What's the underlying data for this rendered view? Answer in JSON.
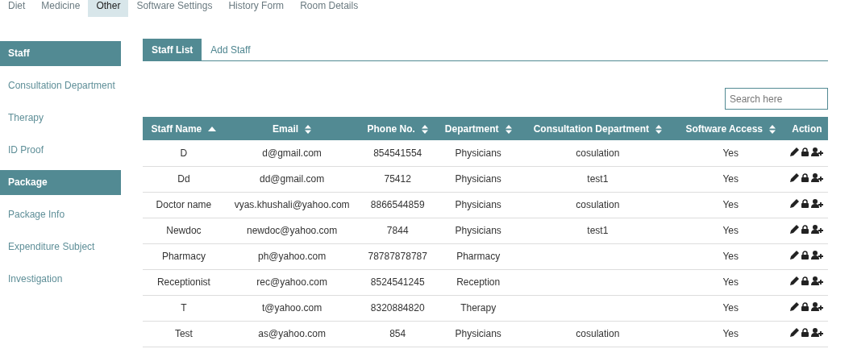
{
  "top_tabs": [
    {
      "label": "Diet",
      "selected": false
    },
    {
      "label": "Medicine",
      "selected": false
    },
    {
      "label": "Other",
      "selected": true
    },
    {
      "label": "Software Settings",
      "selected": false
    },
    {
      "label": "History Form",
      "selected": false
    },
    {
      "label": "Room Details",
      "selected": false
    }
  ],
  "sidebar": {
    "items": [
      {
        "label": "Staff",
        "kind": "header"
      },
      {
        "label": "Consultation Department",
        "kind": "link"
      },
      {
        "label": "Therapy",
        "kind": "link"
      },
      {
        "label": "ID Proof",
        "kind": "link"
      },
      {
        "label": "Package",
        "kind": "header"
      },
      {
        "label": "Package Info",
        "kind": "link"
      },
      {
        "label": "Expenditure Subject",
        "kind": "link"
      },
      {
        "label": "Investigation",
        "kind": "link"
      }
    ]
  },
  "sub_tabs": [
    {
      "label": "Staff List",
      "selected": true
    },
    {
      "label": "Add Staff",
      "selected": false
    }
  ],
  "search": {
    "placeholder": "Search here"
  },
  "table": {
    "columns": [
      {
        "label": "Staff Name",
        "sortable": true,
        "sorted_ascending": true
      },
      {
        "label": "Email",
        "sortable": true,
        "sorted_ascending": false
      },
      {
        "label": "Phone No.",
        "sortable": true,
        "sorted_ascending": false
      },
      {
        "label": "Department",
        "sortable": true,
        "sorted_ascending": false
      },
      {
        "label": "Consultation Department",
        "sortable": true,
        "sorted_ascending": false
      },
      {
        "label": "Software Access",
        "sortable": true,
        "sorted_ascending": false
      },
      {
        "label": "Action",
        "sortable": false,
        "sorted_ascending": false
      }
    ],
    "rows": [
      {
        "cells": [
          "D",
          "d@gmail.com",
          "854541554",
          "Physicians",
          "cosulation",
          "Yes"
        ]
      },
      {
        "cells": [
          "Dd",
          "dd@gmail.com",
          "75412",
          "Physicians",
          "test1",
          "Yes"
        ]
      },
      {
        "cells": [
          "Doctor name",
          "vyas.khushali@yahoo.com",
          "8866544859",
          "Physicians",
          "cosulation",
          "Yes"
        ]
      },
      {
        "cells": [
          "Newdoc",
          "newdoc@yahoo.com",
          "7844",
          "Physicians",
          "test1",
          "Yes"
        ]
      },
      {
        "cells": [
          "Pharmacy",
          "ph@yahoo.com",
          "78787878787",
          "Pharmacy",
          "",
          "Yes"
        ]
      },
      {
        "cells": [
          "Receptionist",
          "rec@yahoo.com",
          "8524541245",
          "Reception",
          "",
          "Yes"
        ]
      },
      {
        "cells": [
          "T",
          "t@yahoo.com",
          "8320884820",
          "Therapy",
          "",
          "Yes"
        ]
      },
      {
        "cells": [
          "Test",
          "as@yahoo.com",
          "854",
          "Physicians",
          "cosulation",
          "Yes"
        ]
      }
    ]
  }
}
